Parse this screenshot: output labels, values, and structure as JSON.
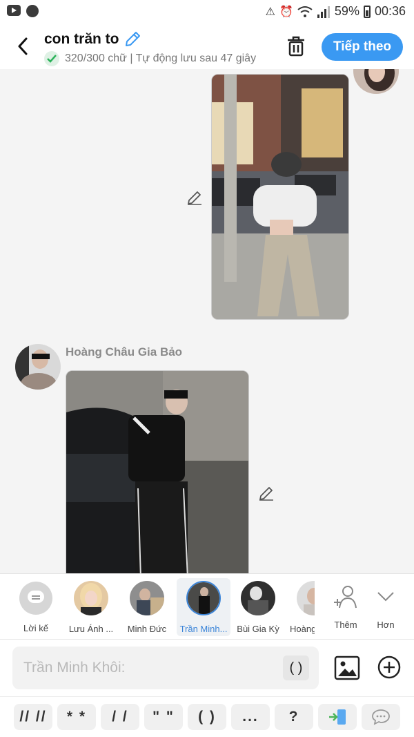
{
  "status_bar": {
    "battery": "59%",
    "time": "00:36"
  },
  "header": {
    "title": "con trăn to",
    "subtitle": "320/300 chữ | Tự động lưu sau 47 giây",
    "next_label": "Tiếp theo"
  },
  "chat": {
    "sender_name": "Hoàng Châu Gia Bảo"
  },
  "suggestions": [
    {
      "label": "Lời kế"
    },
    {
      "label": "Lưu Ánh ..."
    },
    {
      "label": "Minh Đức"
    },
    {
      "label": "Trần Minh..."
    },
    {
      "label": "Bùi Gia Kỳ"
    },
    {
      "label": "Hoàng"
    },
    {
      "label": "Thêm"
    },
    {
      "label": "Hơn"
    }
  ],
  "input": {
    "placeholder": "Trần Minh Khôi:",
    "paren_chip": "( )"
  },
  "symbols": [
    "// //",
    "* *",
    "/ /",
    "\" \"",
    "( )",
    "...",
    "?"
  ],
  "colors": {
    "accent": "#3a99f2",
    "active_label": "#3a84d8"
  }
}
